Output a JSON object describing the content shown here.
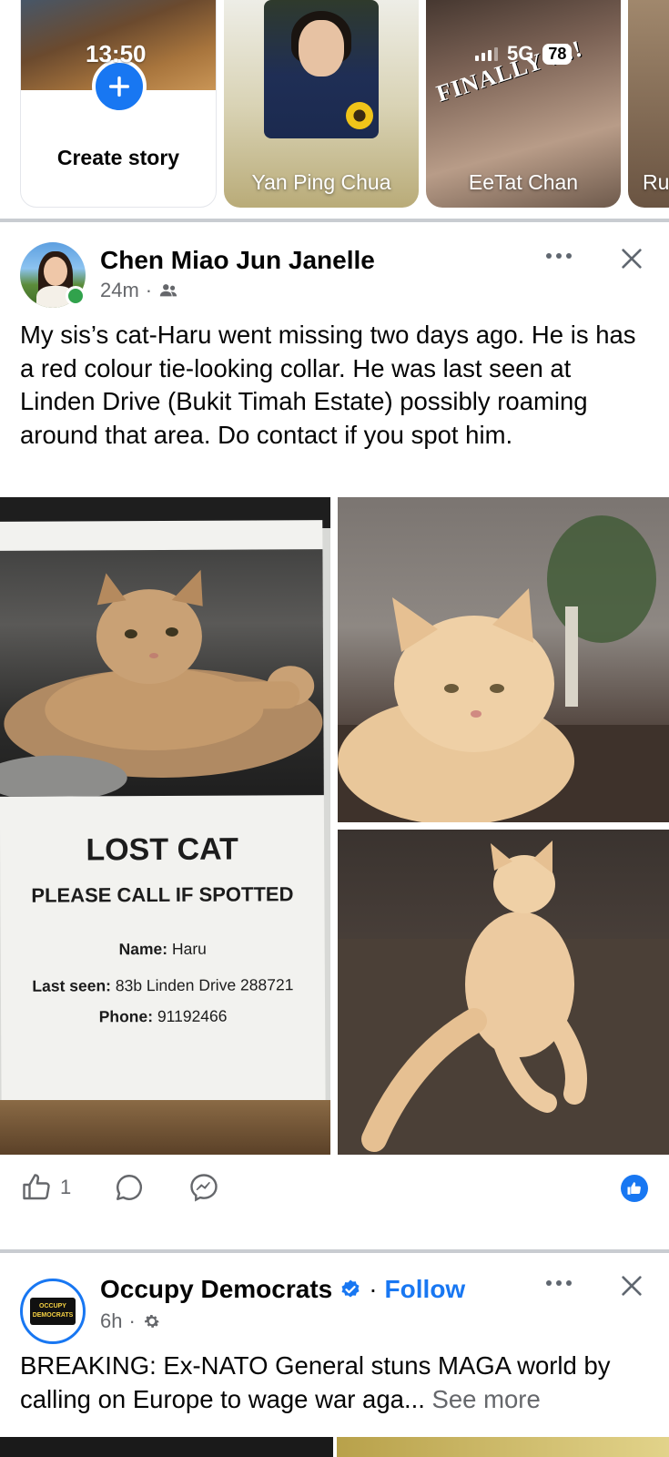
{
  "status_bar": {
    "time": "13:50",
    "network": "5G",
    "battery": "78"
  },
  "stories": [
    {
      "label": "Create story",
      "type": "create"
    },
    {
      "label": "Yan Ping Chua"
    },
    {
      "label": "EeTat Chan",
      "overlay_text": "FINALLY !!!!"
    },
    {
      "label": "Ru"
    }
  ],
  "post1": {
    "author": "Chen Miao Jun Janelle",
    "time": "24m",
    "audience_icon": "friends-icon",
    "text": "My sis’s cat-Haru went missing two days ago. He is has a red colour tie-looking collar. He was last seen at Linden Drive (Bukit Timah Estate) possibly roaming around that area. Do contact if you spot him.",
    "poster": {
      "title": "LOST CAT",
      "subtitle": "PLEASE CALL IF SPOTTED",
      "name_label": "Name:",
      "name_value": "Haru",
      "last_seen_label": "Last seen:",
      "last_seen_value": "83b Linden Drive 288721",
      "phone_label": "Phone:",
      "phone_value": "91192466"
    },
    "like_count": "1"
  },
  "post2": {
    "author": "Occupy Democrats",
    "follow_label": "Follow",
    "separator": "·",
    "time": "6h",
    "text": "BREAKING: Ex-NATO General stuns MAGA world by calling on Europe to wage war aga...",
    "see_more": "See more",
    "avatar_text": "OCCUPY DEMOCRATS"
  },
  "colors": {
    "brand_blue": "#1877f2",
    "secondary_text": "#65676b",
    "online_green": "#31a24c"
  }
}
